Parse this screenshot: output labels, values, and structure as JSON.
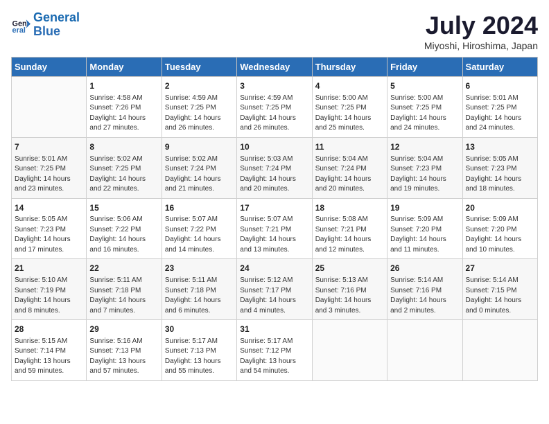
{
  "header": {
    "logo_line1": "General",
    "logo_line2": "Blue",
    "month_year": "July 2024",
    "location": "Miyoshi, Hiroshima, Japan"
  },
  "weekdays": [
    "Sunday",
    "Monday",
    "Tuesday",
    "Wednesday",
    "Thursday",
    "Friday",
    "Saturday"
  ],
  "weeks": [
    [
      {
        "day": "",
        "info": ""
      },
      {
        "day": "1",
        "info": "Sunrise: 4:58 AM\nSunset: 7:26 PM\nDaylight: 14 hours\nand 27 minutes."
      },
      {
        "day": "2",
        "info": "Sunrise: 4:59 AM\nSunset: 7:25 PM\nDaylight: 14 hours\nand 26 minutes."
      },
      {
        "day": "3",
        "info": "Sunrise: 4:59 AM\nSunset: 7:25 PM\nDaylight: 14 hours\nand 26 minutes."
      },
      {
        "day": "4",
        "info": "Sunrise: 5:00 AM\nSunset: 7:25 PM\nDaylight: 14 hours\nand 25 minutes."
      },
      {
        "day": "5",
        "info": "Sunrise: 5:00 AM\nSunset: 7:25 PM\nDaylight: 14 hours\nand 24 minutes."
      },
      {
        "day": "6",
        "info": "Sunrise: 5:01 AM\nSunset: 7:25 PM\nDaylight: 14 hours\nand 24 minutes."
      }
    ],
    [
      {
        "day": "7",
        "info": "Sunrise: 5:01 AM\nSunset: 7:25 PM\nDaylight: 14 hours\nand 23 minutes."
      },
      {
        "day": "8",
        "info": "Sunrise: 5:02 AM\nSunset: 7:25 PM\nDaylight: 14 hours\nand 22 minutes."
      },
      {
        "day": "9",
        "info": "Sunrise: 5:02 AM\nSunset: 7:24 PM\nDaylight: 14 hours\nand 21 minutes."
      },
      {
        "day": "10",
        "info": "Sunrise: 5:03 AM\nSunset: 7:24 PM\nDaylight: 14 hours\nand 20 minutes."
      },
      {
        "day": "11",
        "info": "Sunrise: 5:04 AM\nSunset: 7:24 PM\nDaylight: 14 hours\nand 20 minutes."
      },
      {
        "day": "12",
        "info": "Sunrise: 5:04 AM\nSunset: 7:23 PM\nDaylight: 14 hours\nand 19 minutes."
      },
      {
        "day": "13",
        "info": "Sunrise: 5:05 AM\nSunset: 7:23 PM\nDaylight: 14 hours\nand 18 minutes."
      }
    ],
    [
      {
        "day": "14",
        "info": "Sunrise: 5:05 AM\nSunset: 7:23 PM\nDaylight: 14 hours\nand 17 minutes."
      },
      {
        "day": "15",
        "info": "Sunrise: 5:06 AM\nSunset: 7:22 PM\nDaylight: 14 hours\nand 16 minutes."
      },
      {
        "day": "16",
        "info": "Sunrise: 5:07 AM\nSunset: 7:22 PM\nDaylight: 14 hours\nand 14 minutes."
      },
      {
        "day": "17",
        "info": "Sunrise: 5:07 AM\nSunset: 7:21 PM\nDaylight: 14 hours\nand 13 minutes."
      },
      {
        "day": "18",
        "info": "Sunrise: 5:08 AM\nSunset: 7:21 PM\nDaylight: 14 hours\nand 12 minutes."
      },
      {
        "day": "19",
        "info": "Sunrise: 5:09 AM\nSunset: 7:20 PM\nDaylight: 14 hours\nand 11 minutes."
      },
      {
        "day": "20",
        "info": "Sunrise: 5:09 AM\nSunset: 7:20 PM\nDaylight: 14 hours\nand 10 minutes."
      }
    ],
    [
      {
        "day": "21",
        "info": "Sunrise: 5:10 AM\nSunset: 7:19 PM\nDaylight: 14 hours\nand 8 minutes."
      },
      {
        "day": "22",
        "info": "Sunrise: 5:11 AM\nSunset: 7:18 PM\nDaylight: 14 hours\nand 7 minutes."
      },
      {
        "day": "23",
        "info": "Sunrise: 5:11 AM\nSunset: 7:18 PM\nDaylight: 14 hours\nand 6 minutes."
      },
      {
        "day": "24",
        "info": "Sunrise: 5:12 AM\nSunset: 7:17 PM\nDaylight: 14 hours\nand 4 minutes."
      },
      {
        "day": "25",
        "info": "Sunrise: 5:13 AM\nSunset: 7:16 PM\nDaylight: 14 hours\nand 3 minutes."
      },
      {
        "day": "26",
        "info": "Sunrise: 5:14 AM\nSunset: 7:16 PM\nDaylight: 14 hours\nand 2 minutes."
      },
      {
        "day": "27",
        "info": "Sunrise: 5:14 AM\nSunset: 7:15 PM\nDaylight: 14 hours\nand 0 minutes."
      }
    ],
    [
      {
        "day": "28",
        "info": "Sunrise: 5:15 AM\nSunset: 7:14 PM\nDaylight: 13 hours\nand 59 minutes."
      },
      {
        "day": "29",
        "info": "Sunrise: 5:16 AM\nSunset: 7:13 PM\nDaylight: 13 hours\nand 57 minutes."
      },
      {
        "day": "30",
        "info": "Sunrise: 5:17 AM\nSunset: 7:13 PM\nDaylight: 13 hours\nand 55 minutes."
      },
      {
        "day": "31",
        "info": "Sunrise: 5:17 AM\nSunset: 7:12 PM\nDaylight: 13 hours\nand 54 minutes."
      },
      {
        "day": "",
        "info": ""
      },
      {
        "day": "",
        "info": ""
      },
      {
        "day": "",
        "info": ""
      }
    ]
  ]
}
